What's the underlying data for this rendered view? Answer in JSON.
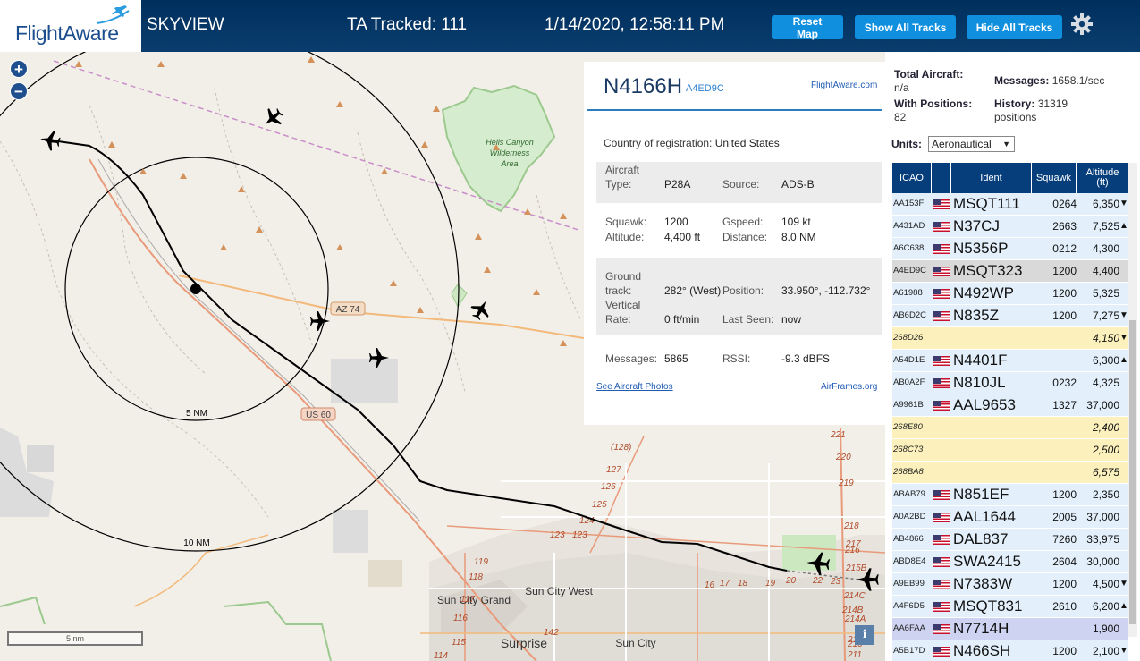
{
  "header": {
    "logo_text": "FlightAware",
    "app_title": "SKYVIEW",
    "ta_tracked": "TA Tracked: 111",
    "clock": "1/14/2020, 12:58:11 PM",
    "reset_map": "Reset Map",
    "show_all": "Show All Tracks",
    "hide_all": "Hide All Tracks",
    "settings_icon": "gear-icon"
  },
  "map": {
    "zoom_in": "+",
    "zoom_out": "−",
    "scale_label": "5 nm",
    "info_label": "i",
    "range_5": "5 NM",
    "range_10": "10 NM",
    "road_az74": "AZ 74",
    "road_us60": "US 60",
    "hells_canyon": [
      "Hells Canyon",
      "Wilderness",
      "Area"
    ],
    "sun_city_grand": "Sun City Grand",
    "sun_city_west": "Sun City West",
    "sun_city": "Sun City",
    "surprise": "Surprise",
    "route_numbers": [
      "(128)",
      "127",
      "126",
      "125",
      "124",
      "123",
      "123",
      "119",
      "118",
      "117",
      "116",
      "115",
      "114",
      "142",
      "17",
      "16",
      "18",
      "19",
      "20",
      "22",
      "23",
      "221",
      "220",
      "219",
      "218",
      "217",
      "216",
      "215B",
      "214C",
      "214B",
      "214A",
      "212",
      "211",
      "210"
    ]
  },
  "popup": {
    "ident": "N4166H",
    "hex": "A4ED9C",
    "fa_link": "FlightAware.com",
    "country_label": "Country of registration:",
    "country": "United States",
    "aircraft_type_label": "Aircraft Type:",
    "aircraft_type_label_1": "Aircraft",
    "aircraft_type_label_2": "Type:",
    "aircraft_type": "P28A",
    "source_label": "Source:",
    "source": "ADS-B",
    "squawk_label": "Squawk:",
    "squawk": "1200",
    "gspeed_label": "Gspeed:",
    "gspeed": "109 kt",
    "altitude_label": "Altitude:",
    "altitude": "4,400 ft",
    "distance_label": "Distance:",
    "distance": "8.0 NM",
    "ground_label_1": "Ground",
    "ground_label_2": "track:",
    "ground_track": "282° (West)",
    "position_label": "Position:",
    "position": "33.950°, -112.732°",
    "vrate_label_1": "Vertical",
    "vrate_label_2": "Rate:",
    "vertical_rate": "0 ft/min",
    "last_seen_label": "Last Seen:",
    "last_seen": "now",
    "messages_label": "Messages:",
    "messages": "5865",
    "rssi_label": "RSSI:",
    "rssi": "-9.3 dBFS",
    "photos_link": "See Aircraft Photos",
    "airframes_link": "AirFrames.org"
  },
  "side": {
    "total_aircraft_label": "Total Aircraft:",
    "total_aircraft": "n/a",
    "with_positions_label": "With Positions:",
    "with_positions": "82",
    "messages_label": "Messages:",
    "messages": "1658.1/sec",
    "history_label": "History:",
    "history": "31319",
    "history_unit": "positions",
    "units_label": "Units:",
    "units_value": "Aeronautical",
    "columns": [
      "ICAO",
      "Ident",
      "Squawk",
      "Altitude (ft)"
    ],
    "col_alt_1": "Altitude",
    "col_alt_2": "(ft)",
    "rows": [
      {
        "icao": "AA153F",
        "ident": "MSQT111",
        "squawk": "0264",
        "alt": "6,350",
        "trend": "▼",
        "flag": true,
        "bg": "#e3f0fb"
      },
      {
        "icao": "A431AD",
        "ident": "N37CJ",
        "squawk": "2663",
        "alt": "7,525",
        "trend": "▲",
        "flag": true,
        "bg": "#e3f0fb"
      },
      {
        "icao": "A6C638",
        "ident": "N5356P",
        "squawk": "0212",
        "alt": "4,300",
        "trend": "",
        "flag": true,
        "bg": "#e3f0fb"
      },
      {
        "icao": "A4ED9C",
        "ident": "MSQT323",
        "squawk": "1200",
        "alt": "4,400",
        "trend": "",
        "flag": true,
        "bg": "#d9d9d9"
      },
      {
        "icao": "A61988",
        "ident": "N492WP",
        "squawk": "1200",
        "alt": "5,325",
        "trend": "",
        "flag": true,
        "bg": "#e3f0fb"
      },
      {
        "icao": "AB6D2C",
        "ident": "N835Z",
        "squawk": "1200",
        "alt": "7,275",
        "trend": "▼",
        "flag": true,
        "bg": "#e3f0fb"
      },
      {
        "icao": "268D26",
        "ident": "",
        "squawk": "",
        "alt": "4,150",
        "trend": "▼",
        "flag": false,
        "bg": "#fcf1bd"
      },
      {
        "icao": "A54D1E",
        "ident": "N4401F",
        "squawk": "",
        "alt": "6,300",
        "trend": "▲",
        "flag": true,
        "bg": "#e3f0fb"
      },
      {
        "icao": "AB0A2F",
        "ident": "N810JL",
        "squawk": "0232",
        "alt": "4,325",
        "trend": "",
        "flag": true,
        "bg": "#e3f0fb"
      },
      {
        "icao": "A9961B",
        "ident": "AAL9653",
        "squawk": "1327",
        "alt": "37,000",
        "trend": "",
        "flag": true,
        "bg": "#e3f0fb"
      },
      {
        "icao": "268E80",
        "ident": "",
        "squawk": "",
        "alt": "2,400",
        "trend": "",
        "flag": false,
        "bg": "#fcf1bd"
      },
      {
        "icao": "268C73",
        "ident": "",
        "squawk": "",
        "alt": "2,500",
        "trend": "",
        "flag": false,
        "bg": "#fcf1bd"
      },
      {
        "icao": "268BA8",
        "ident": "",
        "squawk": "",
        "alt": "6,575",
        "trend": "",
        "flag": false,
        "bg": "#fcf1bd"
      },
      {
        "icao": "ABAB79",
        "ident": "N851EF",
        "squawk": "1200",
        "alt": "2,350",
        "trend": "",
        "flag": true,
        "bg": "#e3f0fb"
      },
      {
        "icao": "A0A2BD",
        "ident": "AAL1644",
        "squawk": "2005",
        "alt": "37,000",
        "trend": "",
        "flag": true,
        "bg": "#e3f0fb"
      },
      {
        "icao": "AB4866",
        "ident": "DAL837",
        "squawk": "7260",
        "alt": "33,975",
        "trend": "",
        "flag": true,
        "bg": "#e3f0fb"
      },
      {
        "icao": "ABD8E4",
        "ident": "SWA2415",
        "squawk": "2604",
        "alt": "30,000",
        "trend": "",
        "flag": true,
        "bg": "#e3f0fb"
      },
      {
        "icao": "A9EB99",
        "ident": "N7383W",
        "squawk": "1200",
        "alt": "4,500",
        "trend": "▼",
        "flag": true,
        "bg": "#e3f0fb"
      },
      {
        "icao": "A4F6D5",
        "ident": "MSQT831",
        "squawk": "2610",
        "alt": "6,200",
        "trend": "▲",
        "flag": true,
        "bg": "#e3f0fb"
      },
      {
        "icao": "AA6FAA",
        "ident": "N7714H",
        "squawk": "",
        "alt": "1,900",
        "trend": "",
        "flag": true,
        "bg": "#cfd3f2"
      },
      {
        "icao": "A5B17D",
        "ident": "N466SH",
        "squawk": "1200",
        "alt": "2,100",
        "trend": "▼",
        "flag": true,
        "bg": "#e3f0fb"
      }
    ]
  },
  "colors": {
    "header_bg": "#002f5d",
    "button_blue": "#0f8fde",
    "table_header": "#063e7c",
    "row_plain": "#e3f0fb",
    "row_nonus": "#fcf1bd",
    "row_selected": "#d9d9d9"
  }
}
